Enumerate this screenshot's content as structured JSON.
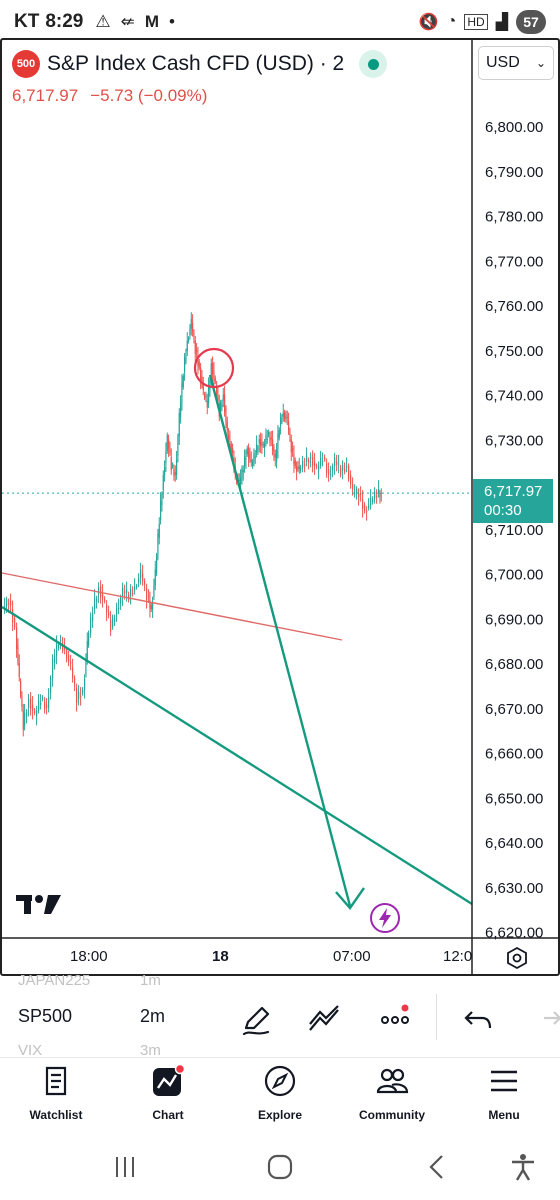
{
  "status_bar": {
    "carrier": "KT",
    "time": "8:29",
    "left_icons": [
      "warning-icon",
      "muted-notification-icon",
      "gmail-icon",
      "dot-icon"
    ],
    "right_icons": [
      "mute-icon",
      "wifi-icon",
      "hd-icon",
      "signal-icon"
    ],
    "battery": "57"
  },
  "chart": {
    "symbol_badge": "500",
    "title": "S&P Index Cash CFD (USD) · 2",
    "last_price": "6,717.97",
    "change": "−5.73 (−0.09%)",
    "currency": "USD",
    "price_tag": {
      "price": "6,717.97",
      "countdown": "00:30"
    },
    "price_axis": [
      "6,800.00",
      "6,790.00",
      "6,780.00",
      "6,770.00",
      "6,760.00",
      "6,750.00",
      "6,740.00",
      "6,730.00",
      "6,720.00",
      "6,710.00",
      "6,700.00",
      "6,690.00",
      "6,680.00",
      "6,670.00",
      "6,660.00",
      "6,650.00",
      "6,640.00",
      "6,630.00",
      "6,620.00"
    ],
    "time_axis": [
      {
        "label": "18:00",
        "bold": false
      },
      {
        "label": "18",
        "bold": true
      },
      {
        "label": "07:00",
        "bold": false
      },
      {
        "label": "12:0",
        "bold": false
      }
    ],
    "colors": {
      "up": "#26a69a",
      "down": "#ef5350",
      "drawing_green": "#149a7e",
      "drawing_red": "#e06a6a",
      "circle": "#e53950"
    }
  },
  "toolbar": {
    "symbols": [
      {
        "symbol": "JAPAN225",
        "interval": "1m",
        "state": "faded"
      },
      {
        "symbol": "SP500",
        "interval": "2m",
        "state": "active"
      },
      {
        "symbol": "VIX",
        "interval": "3m",
        "state": "faded"
      }
    ],
    "tools": [
      "pen-icon",
      "trend-line-icon",
      "more-icon",
      "undo-icon",
      "redo-icon"
    ]
  },
  "bottom_nav": [
    {
      "label": "Watchlist",
      "icon": "watchlist-icon"
    },
    {
      "label": "Chart",
      "icon": "chart-icon",
      "active": true
    },
    {
      "label": "Explore",
      "icon": "compass-icon"
    },
    {
      "label": "Community",
      "icon": "community-icon"
    },
    {
      "label": "Menu",
      "icon": "menu-icon"
    }
  ],
  "system_nav": [
    "recents-icon",
    "home-icon",
    "back-icon",
    "accessibility-icon"
  ]
}
